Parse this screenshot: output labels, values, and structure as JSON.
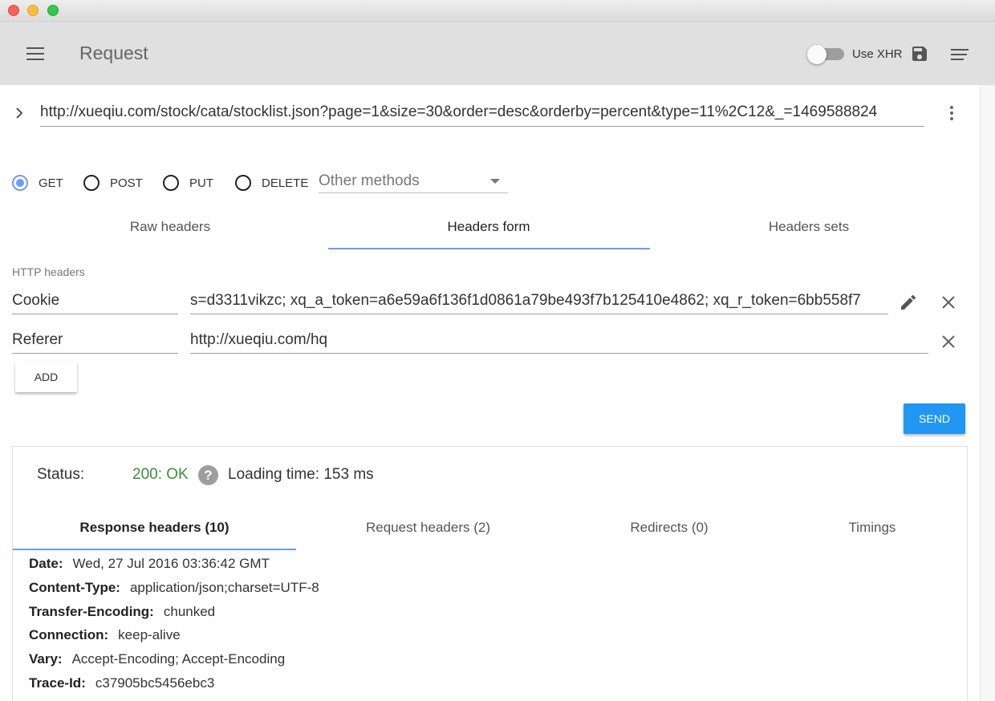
{
  "toolbar": {
    "title": "Request",
    "xhr_label": "Use XHR"
  },
  "url": {
    "value": "http://xueqiu.com/stock/cata/stocklist.json?page=1&size=30&order=desc&orderby=percent&type=11%2C12&_=1469588824"
  },
  "methods": {
    "options": [
      "GET",
      "POST",
      "PUT",
      "DELETE"
    ],
    "selected": "GET",
    "other_placeholder": "Other methods"
  },
  "header_tabs": [
    "Raw headers",
    "Headers form",
    "Headers sets"
  ],
  "header_tabs_active": "Headers form",
  "headers_section": {
    "label": "HTTP headers",
    "rows": [
      {
        "name": "Cookie",
        "value": "s=d3311vikzc; xq_a_token=a6e59a6f136f1d0861a79be493f7b125410e4862; xq_r_token=6bb558f7"
      },
      {
        "name": "Referer",
        "value": "http://xueqiu.com/hq"
      }
    ],
    "add_label": "ADD"
  },
  "send_label": "SEND",
  "response": {
    "status_label": "Status:",
    "status_value": "200: OK",
    "help_glyph": "?",
    "loading_time": "Loading time: 153 ms",
    "tabs": [
      "Response headers (10)",
      "Request headers (2)",
      "Redirects (0)",
      "Timings"
    ],
    "active_tab": "Response headers (10)",
    "headers": [
      {
        "name": "Date:",
        "value": "Wed, 27 Jul 2016 03:36:42 GMT"
      },
      {
        "name": "Content-Type:",
        "value": "application/json;charset=UTF-8"
      },
      {
        "name": "Transfer-Encoding:",
        "value": "chunked"
      },
      {
        "name": "Connection:",
        "value": "keep-alive"
      },
      {
        "name": "Vary:",
        "value": "Accept-Encoding; Accept-Encoding"
      },
      {
        "name": "Trace-Id:",
        "value": "c37905bc5456ebc3"
      }
    ]
  },
  "colors": {
    "accent": "#6a9cf7",
    "send": "#2196f3",
    "status_ok": "#388e3c",
    "toolbar_bg": "#e0e0e0"
  },
  "icons": [
    "menu-icon",
    "toggle-switch",
    "save-icon",
    "sort-icon",
    "chevron-right-icon",
    "more-vert-icon",
    "edit-icon",
    "close-icon",
    "help-icon"
  ]
}
